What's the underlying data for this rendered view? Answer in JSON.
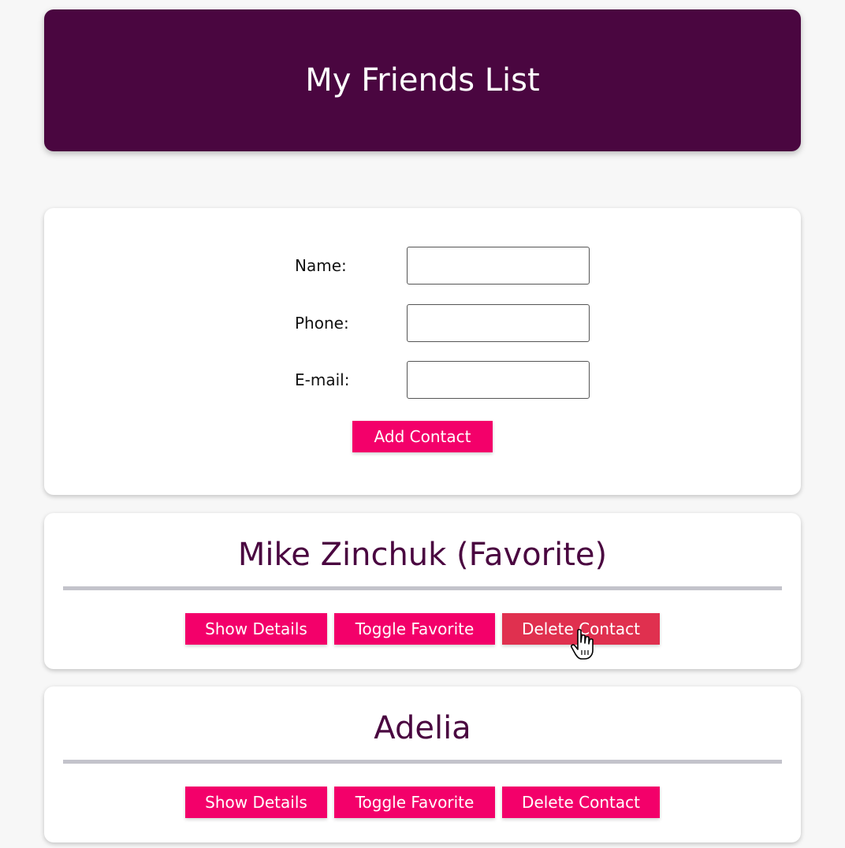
{
  "header": {
    "title": "My Friends List"
  },
  "form": {
    "fields": [
      {
        "label": "Name:",
        "value": ""
      },
      {
        "label": "Phone:",
        "value": ""
      },
      {
        "label": "E-mail:",
        "value": ""
      }
    ],
    "submit_label": "Add Contact"
  },
  "contacts": [
    {
      "name": "Mike Zinchuk (Favorite)",
      "show_label": "Show Details",
      "toggle_label": "Toggle Favorite",
      "delete_label": "Delete Contact"
    },
    {
      "name": "Adelia",
      "show_label": "Show Details",
      "toggle_label": "Toggle Favorite",
      "delete_label": "Delete Contact"
    }
  ],
  "colors": {
    "header_bg": "#4a0640",
    "button_bg": "#f3006a",
    "button_hover_bg": "#e0304f",
    "name_color": "#4a0640"
  },
  "cursor": {
    "icon": "hand-pointer-icon"
  }
}
